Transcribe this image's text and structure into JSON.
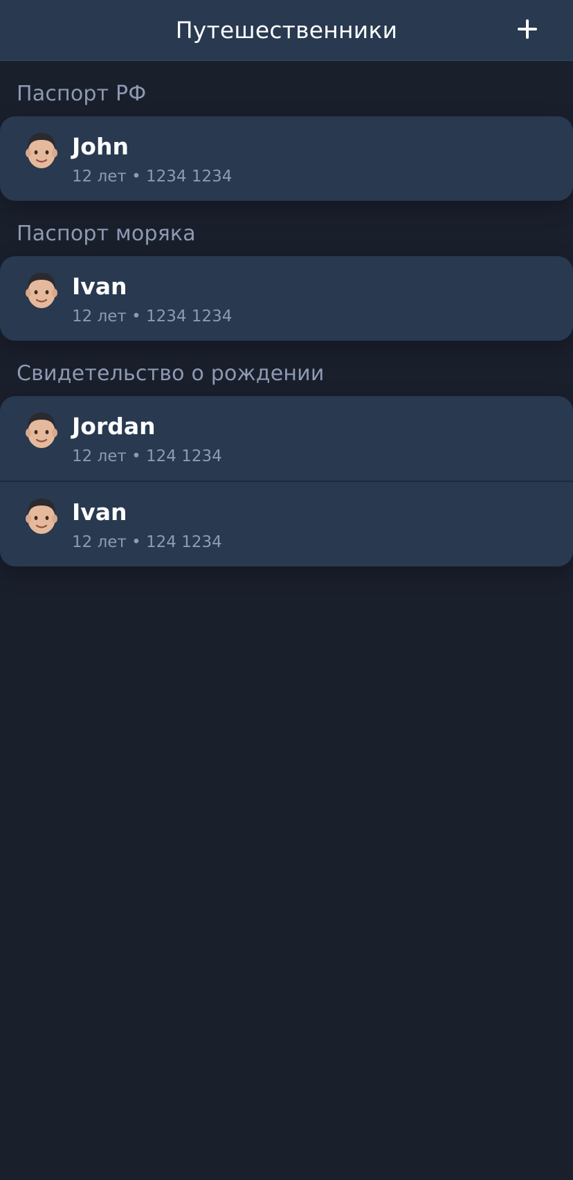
{
  "header": {
    "title": "Путешественники",
    "add_icon": "plus-icon"
  },
  "sections": [
    {
      "title": "Паспорт РФ",
      "travelers": [
        {
          "name": "John",
          "details": "12 лет • 1234 1234",
          "avatar": "man-emoji-avatar"
        }
      ]
    },
    {
      "title": "Паспорт моряка",
      "travelers": [
        {
          "name": "Ivan",
          "details": "12 лет • 1234 1234",
          "avatar": "man-emoji-avatar"
        }
      ]
    },
    {
      "title": "Свидетельство о рождении",
      "travelers": [
        {
          "name": "Jordan",
          "details": "12 лет • 124 1234",
          "avatar": "man-emoji-avatar"
        },
        {
          "name": "Ivan",
          "details": "12 лет • 124 1234",
          "avatar": "man-emoji-avatar"
        }
      ]
    }
  ],
  "colors": {
    "background": "#1a1f2c",
    "header": "#283950",
    "card": "#283950",
    "secondary_text": "#8d9bb3",
    "primary_text": "#ffffff"
  }
}
